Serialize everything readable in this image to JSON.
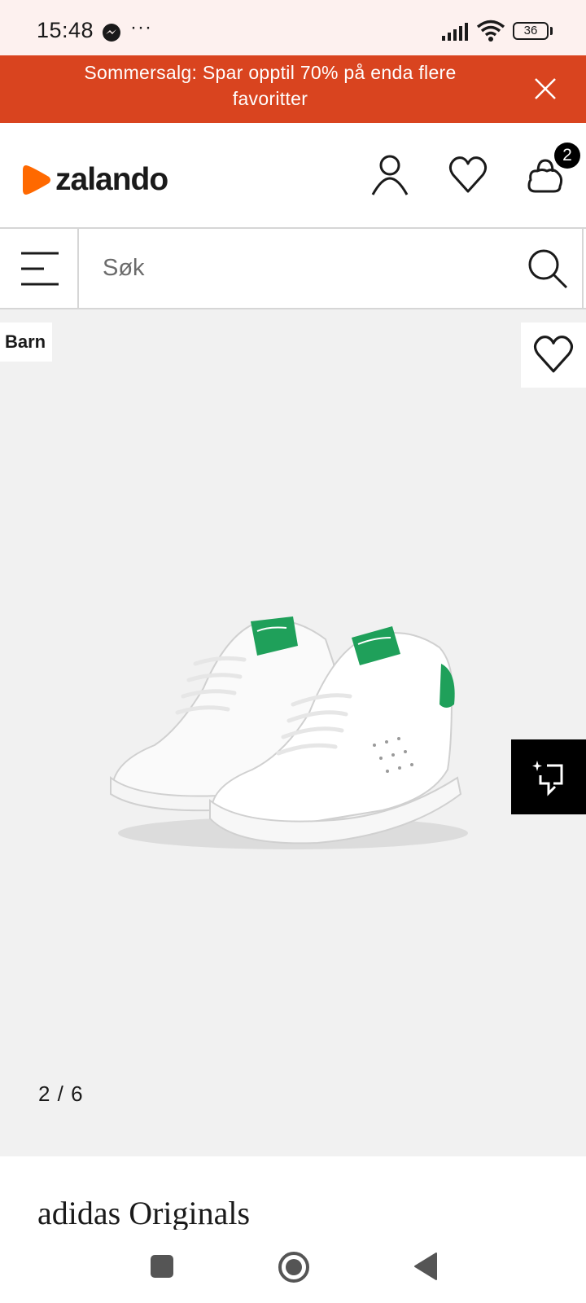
{
  "status_bar": {
    "time": "15:48",
    "more": "···",
    "battery": "36"
  },
  "promo_banner": {
    "text": "Sommersalg: Spar opptil 70% på enda flere favoritter",
    "background_color": "#d9441f"
  },
  "header": {
    "logo_text": "zalando",
    "logo_color": "#ff6900",
    "icons": [
      "account-icon",
      "wishlist-heart-icon",
      "shopping-bag-icon"
    ],
    "bag_count": "2"
  },
  "search": {
    "placeholder": "Søk",
    "value": ""
  },
  "product_gallery": {
    "tag": "Barn",
    "image_description_icon": "white-sneakers-with-green-heel",
    "current_image": "2",
    "total_images": "6",
    "counter_text": "2 / 6"
  },
  "product": {
    "brand": "adidas Originals"
  },
  "nav_bar": {
    "icons": [
      "recent-apps-icon",
      "home-icon",
      "back-icon"
    ]
  }
}
